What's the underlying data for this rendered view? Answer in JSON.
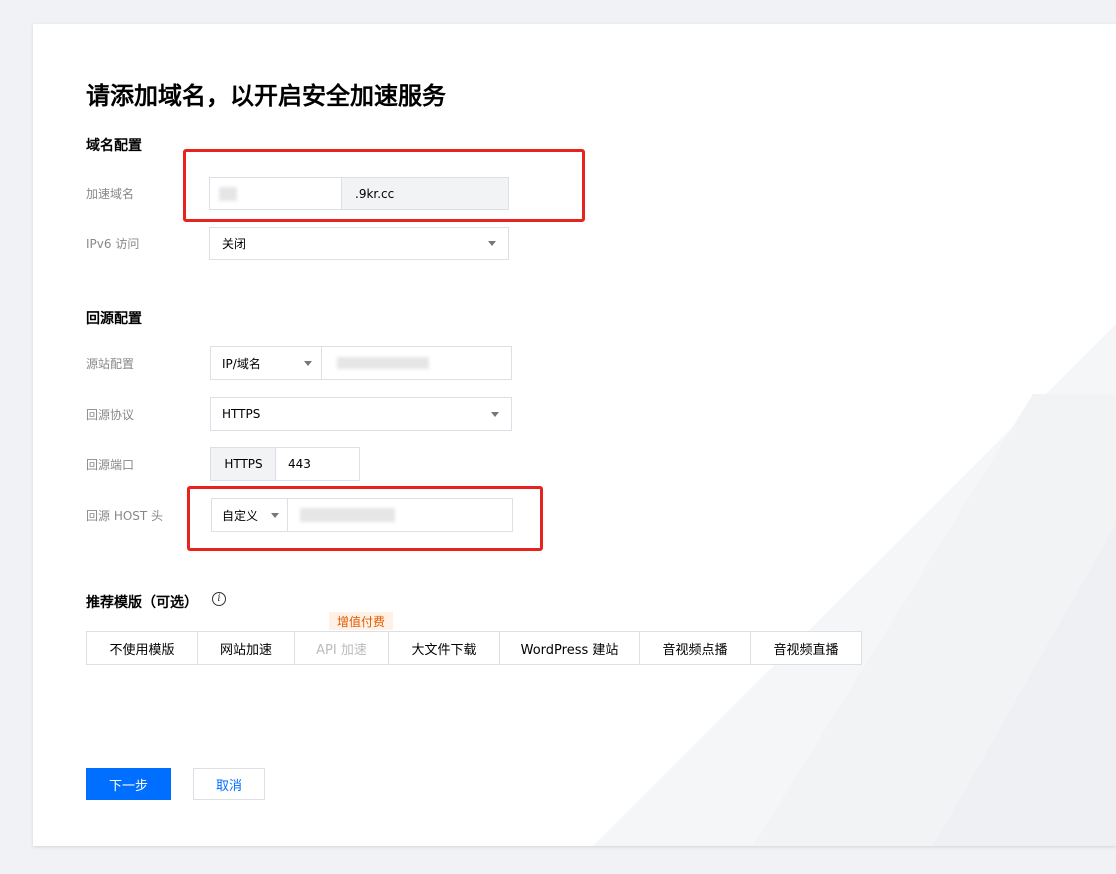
{
  "page": {
    "title": "请添加域名，以开启安全加速服务"
  },
  "domain_config": {
    "section_title": "域名配置",
    "accel_domain_label": "加速域名",
    "domain_suffix": ".9kr.cc",
    "ipv6_label": "IPv6 访问",
    "ipv6_value": "关闭"
  },
  "origin_config": {
    "section_title": "回源配置",
    "origin_label": "源站配置",
    "origin_type": "IP/域名",
    "protocol_label": "回源协议",
    "protocol_value": "HTTPS",
    "port_label": "回源端口",
    "port_protocol": "HTTPS",
    "port_value": "443",
    "host_label": "回源 HOST 头",
    "host_type": "自定义"
  },
  "templates": {
    "section_title": "推荐模版（可选）",
    "badge": "增值付费",
    "items": [
      {
        "label": "不使用模版",
        "disabled": false
      },
      {
        "label": "网站加速",
        "disabled": false
      },
      {
        "label": "API 加速",
        "disabled": true
      },
      {
        "label": "大文件下载",
        "disabled": false
      },
      {
        "label": "WordPress 建站",
        "disabled": false
      },
      {
        "label": "音视频点播",
        "disabled": false
      },
      {
        "label": "音视频直播",
        "disabled": false
      }
    ]
  },
  "actions": {
    "next": "下一步",
    "cancel": "取消"
  },
  "icons": {
    "info": "info-icon",
    "dropdown": "caret-down-icon"
  },
  "colors": {
    "primary": "#006eff",
    "highlight": "#e8231d",
    "badge_bg": "#fff1e6",
    "badge_text": "#e05a00"
  }
}
